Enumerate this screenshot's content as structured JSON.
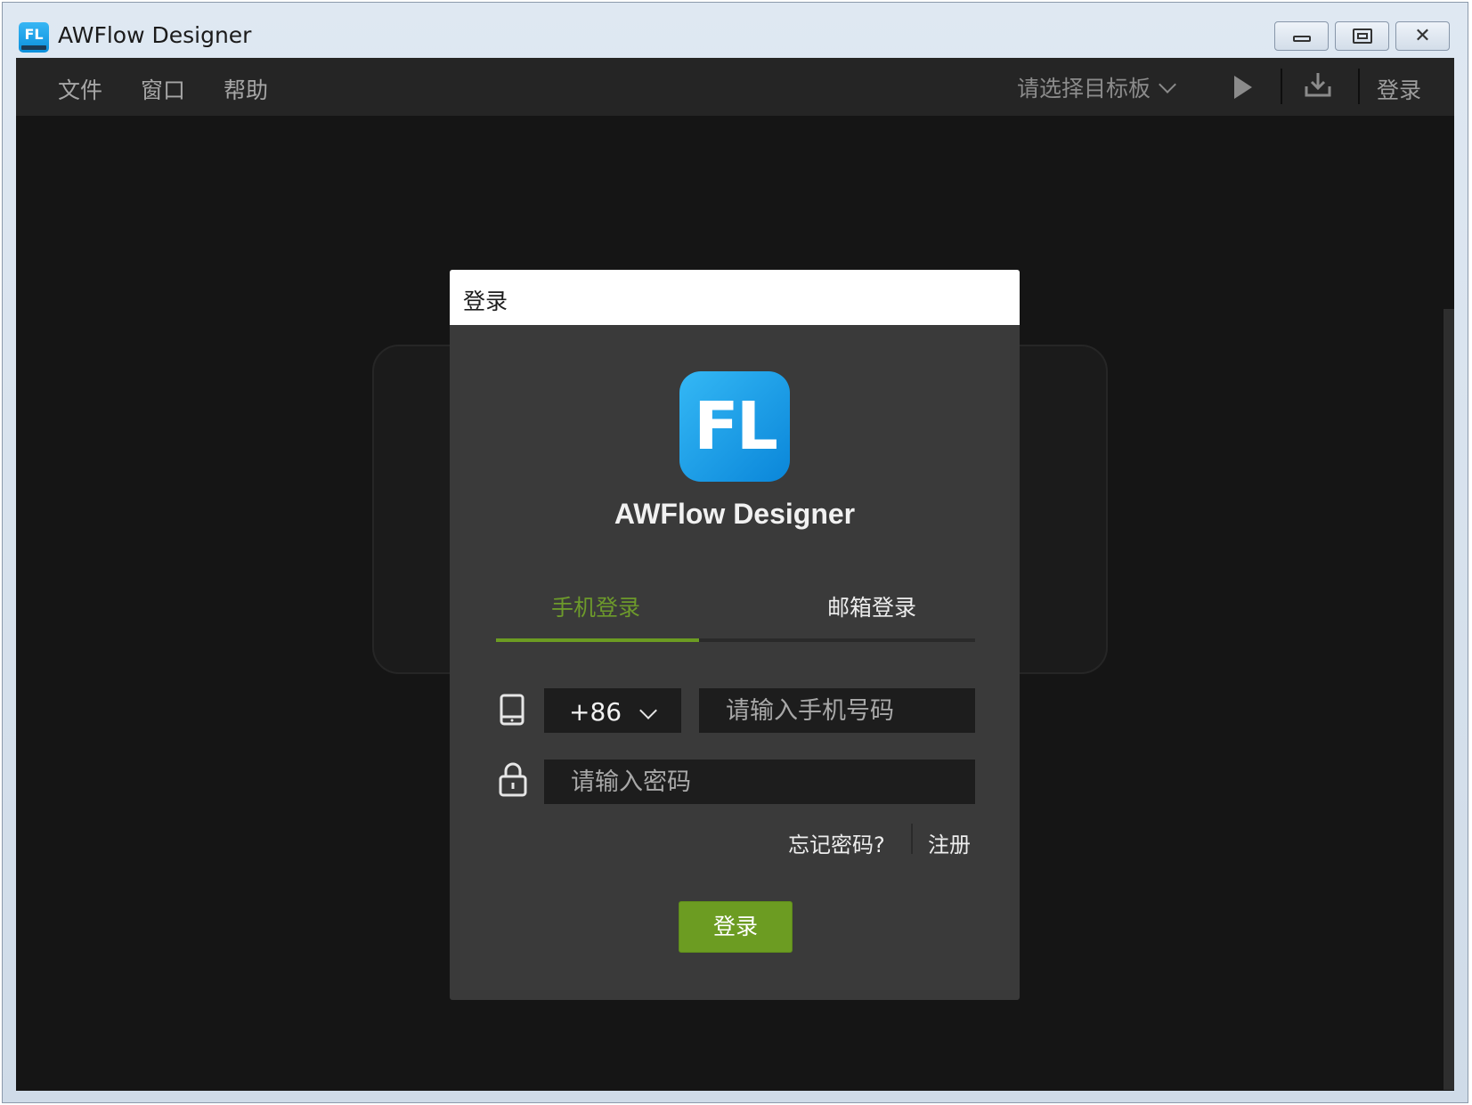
{
  "window": {
    "title": "AWFlow Designer",
    "icon_label": "FL",
    "controls": [
      "minimize-icon",
      "maximize-icon",
      "close-icon"
    ]
  },
  "menubar": {
    "items": [
      "文件",
      "窗口",
      "帮助"
    ],
    "board_select": "请选择目标板",
    "login": "登录"
  },
  "dialog": {
    "title": "登录",
    "logo_text": "FL",
    "app_name": "AWFlow Designer",
    "tabs": [
      {
        "label": "手机登录",
        "active": true
      },
      {
        "label": "邮箱登录",
        "active": false
      }
    ],
    "country_code": "+86",
    "phone_placeholder": "请输入手机号码",
    "password_placeholder": "请输入密码",
    "forgot_password": "忘记密码?",
    "register": "注册",
    "login_button": "登录"
  },
  "colors": {
    "accent": "#6c9c22",
    "dialog_bg": "#3a3a3a",
    "client_bg": "#151515",
    "menubar_bg": "#252525"
  }
}
